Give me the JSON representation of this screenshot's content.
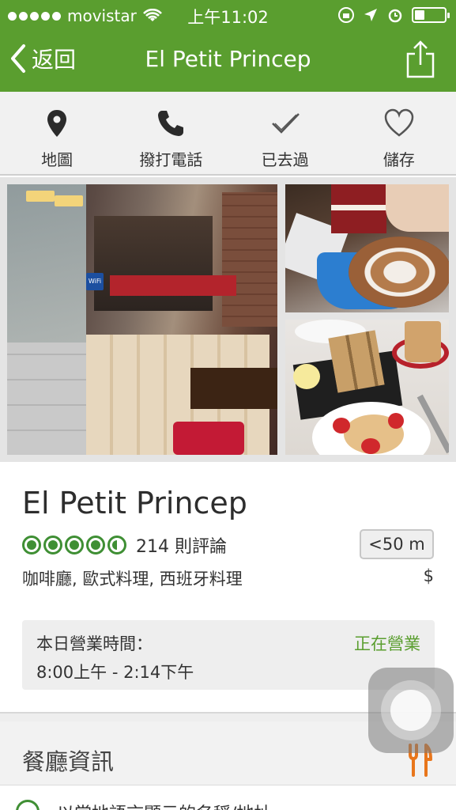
{
  "status_bar": {
    "carrier": "movistar",
    "time": "上午11:02"
  },
  "nav": {
    "back_label": "返回",
    "title": "El Petit Princep"
  },
  "actions": [
    {
      "label": "地圖",
      "icon": "map-pin-icon"
    },
    {
      "label": "撥打電話",
      "icon": "phone-icon"
    },
    {
      "label": "已去過",
      "icon": "check-icon"
    },
    {
      "label": "儲存",
      "icon": "heart-icon"
    }
  ],
  "restaurant": {
    "name": "El Petit Princep",
    "rating": 4.5,
    "rating_max": 5,
    "reviews": "214 則評論",
    "distance": "<50 m",
    "cuisine": "咖啡廳, 歐式料理, 西班牙料理",
    "price": "$"
  },
  "hours": {
    "label": "本日營業時間：",
    "status": "正在營業",
    "time": "8:00上午 - 2:14下午"
  },
  "section": {
    "title": "餐廳資訊"
  },
  "next_row": {
    "text": "以當地語言顯示的名稱/地址"
  },
  "colors": {
    "brand_green": "#5a9e2f",
    "rating_green": "#3f8f34",
    "accent_orange": "#e8761c"
  }
}
